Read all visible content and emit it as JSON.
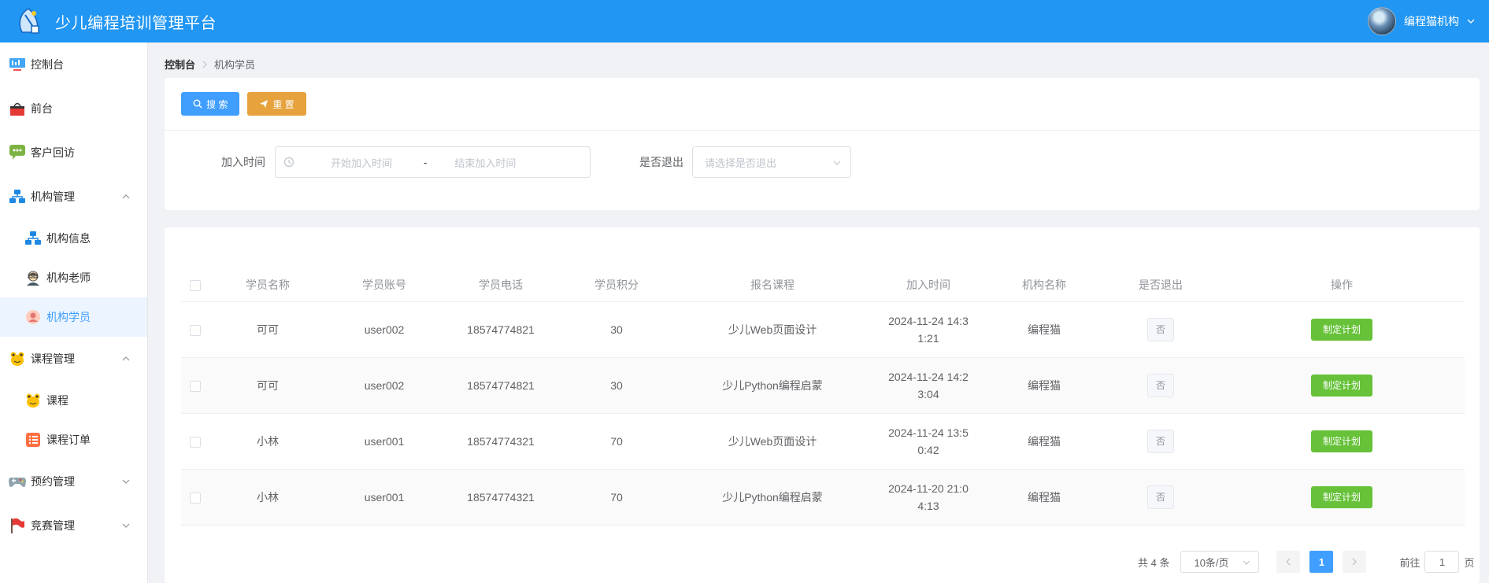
{
  "header": {
    "title": "少儿编程培训管理平台",
    "user_name": "编程猫机构"
  },
  "sidebar": {
    "items": [
      {
        "label": "控制台",
        "icon": "dashboard-icon"
      },
      {
        "label": "前台",
        "icon": "basket-icon"
      },
      {
        "label": "客户回访",
        "icon": "chat-icon"
      },
      {
        "label": "机构管理",
        "icon": "org-chart-icon"
      },
      {
        "label": "机构信息",
        "icon": "org-chart-icon"
      },
      {
        "label": "机构老师",
        "icon": "teacher-icon"
      },
      {
        "label": "机构学员",
        "icon": "student-icon"
      },
      {
        "label": "课程管理",
        "icon": "frog-icon"
      },
      {
        "label": "课程",
        "icon": "frog-icon"
      },
      {
        "label": "课程订单",
        "icon": "order-list-icon"
      },
      {
        "label": "预约管理",
        "icon": "gamepad-icon"
      },
      {
        "label": "竞赛管理",
        "icon": "flag-icon"
      }
    ],
    "active_item": "机构学员"
  },
  "breadcrumb": {
    "root": "控制台",
    "current": "机构学员"
  },
  "search": {
    "search_label": "搜 索",
    "reset_label": "重 置",
    "join_time_label": "加入时间",
    "start_placeholder": "开始加入时间",
    "range_separator": "-",
    "end_placeholder": "结束加入时间",
    "quit_label": "是否退出",
    "quit_placeholder": "请选择是否退出"
  },
  "table": {
    "columns": [
      "学员名称",
      "学员账号",
      "学员电话",
      "学员积分",
      "报名课程",
      "加入时间",
      "机构名称",
      "是否退出",
      "操作"
    ],
    "rows": [
      {
        "name": "可可",
        "account": "user002",
        "phone": "18574774821",
        "points": "30",
        "course": "少儿Web页面设计",
        "join_time": "2024-11-24 14:31:21",
        "org": "编程猫",
        "quit": "否",
        "action": "制定计划"
      },
      {
        "name": "可可",
        "account": "user002",
        "phone": "18574774821",
        "points": "30",
        "course": "少儿Python编程启蒙",
        "join_time": "2024-11-24 14:23:04",
        "org": "编程猫",
        "quit": "否",
        "action": "制定计划"
      },
      {
        "name": "小林",
        "account": "user001",
        "phone": "18574774321",
        "points": "70",
        "course": "少儿Web页面设计",
        "join_time": "2024-11-24 13:50:42",
        "org": "编程猫",
        "quit": "否",
        "action": "制定计划"
      },
      {
        "name": "小林",
        "account": "user001",
        "phone": "18574774321",
        "points": "70",
        "course": "少儿Python编程启蒙",
        "join_time": "2024-11-20 21:04:13",
        "org": "编程猫",
        "quit": "否",
        "action": "制定计划"
      }
    ]
  },
  "pagination": {
    "total": "共 4 条",
    "page_size": "10条/页",
    "current_page": "1",
    "goto_label": "前往",
    "goto_value": "1",
    "page_unit": "页"
  },
  "colors": {
    "header": "#2196f3",
    "primary": "#409eff",
    "warning": "#e6a23c",
    "success": "#67c23a"
  }
}
